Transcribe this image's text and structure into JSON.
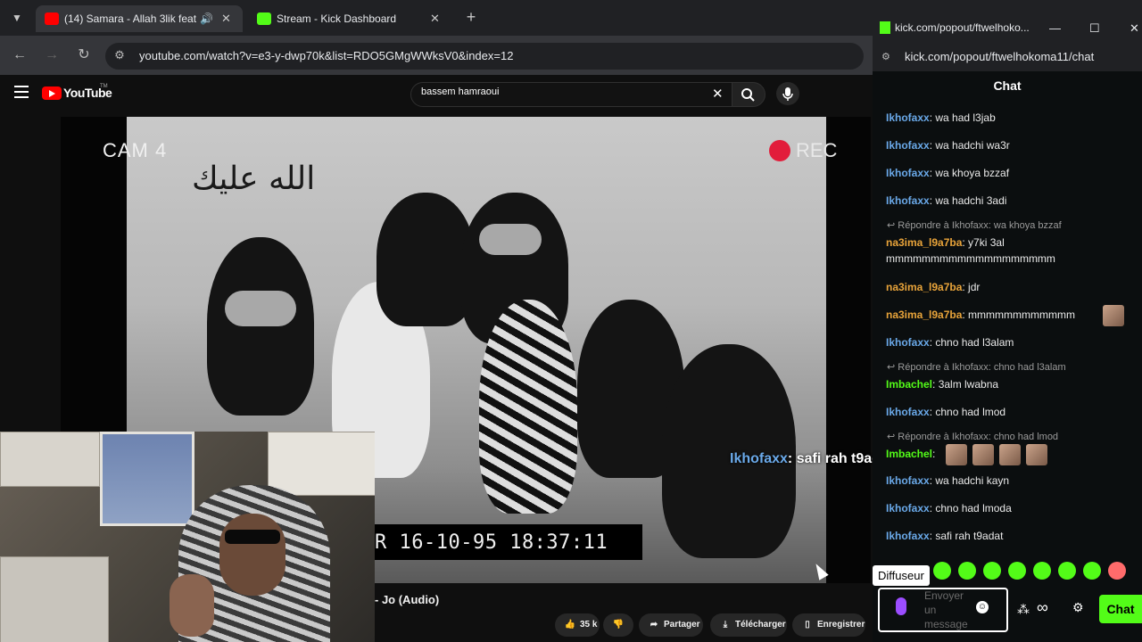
{
  "browser": {
    "tabs": [
      {
        "label": "(14) Samara - Allah 3lik feat",
        "active": true
      },
      {
        "label": "Stream - Kick Dashboard",
        "active": false
      }
    ],
    "url": "youtube.com/watch?v=e3-y-dwp70k&list=RDO5GMgWWksV0&index=12"
  },
  "youtube": {
    "logo_text": "YouTube",
    "logo_tm": "TM",
    "search_value": "bassem hamraoui",
    "video": {
      "cam_label": "CAM 4",
      "rec_label": "REC",
      "arabic_text": "الله عليك",
      "timestamp": "R 16-10-95 18:37:11",
      "overlay_chat_user": "Ikhofaxx",
      "overlay_chat_message": ": safi rah t9adat"
    },
    "title_fragment": "- Jo (Audio)",
    "actions": {
      "likes": "35 k",
      "share": "Partager",
      "download": "Télécharger",
      "save": "Enregistrer"
    }
  },
  "kick": {
    "window_title": "kick.com/popout/ftwelhoko...",
    "url": "kick.com/popout/ftwelhokoma11/chat",
    "chat_header": "Chat",
    "messages": [
      {
        "user": "Ikhofaxx",
        "text": ": wa had l3jab",
        "color": "#6aa9e9"
      },
      {
        "user": "Ikhofaxx",
        "text": ": wa hadchi wa3r",
        "color": "#6aa9e9"
      },
      {
        "user": "Ikhofaxx",
        "text": ": wa khoya bzzaf",
        "color": "#6aa9e9"
      },
      {
        "user": "Ikhofaxx",
        "text": ": wa hadchi 3adi",
        "color": "#6aa9e9"
      },
      {
        "reply": "Répondre à Ikhofaxx: wa khoya bzzaf"
      },
      {
        "user": "na3ima_l9a7ba",
        "text": ": y7ki 3al mmmmmmmmmmmmmmmmmmm",
        "color": "#e9a43a"
      },
      {
        "user": "na3ima_l9a7ba",
        "text": ": jdr",
        "color": "#e9a43a"
      },
      {
        "user": "na3ima_l9a7ba",
        "text": ": mmmmmmmmmmmm",
        "color": "#e9a43a"
      },
      {
        "user": "Ikhofaxx",
        "text": ": chno had l3alam",
        "color": "#6aa9e9"
      },
      {
        "reply": "Répondre à Ikhofaxx: chno had l3alam"
      },
      {
        "user": "Imbachel",
        "text": ": 3alm lwabna",
        "color": "#53fc18"
      },
      {
        "user": "Ikhofaxx",
        "text": ": chno had lmod",
        "color": "#6aa9e9"
      },
      {
        "reply": "Répondre à Ikhofaxx: chno had lmod"
      },
      {
        "user": "Imbachel",
        "text": ":",
        "color": "#53fc18"
      },
      {
        "user": "Ikhofaxx",
        "text": ": wa hadchi kayn",
        "color": "#6aa9e9"
      },
      {
        "user": "Ikhofaxx",
        "text": ": chno had lmoda",
        "color": "#6aa9e9"
      },
      {
        "user": "Ikhofaxx",
        "text": ": safi rah t9adat",
        "color": "#6aa9e9"
      }
    ],
    "tooltip": "Diffuseur",
    "input_placeholder": "Envoyer un message",
    "send_label": "Chat"
  },
  "colors": {
    "kick_green": "#53fc18",
    "youtube_red": "#ff0000",
    "rec_red": "#e21d3b"
  }
}
